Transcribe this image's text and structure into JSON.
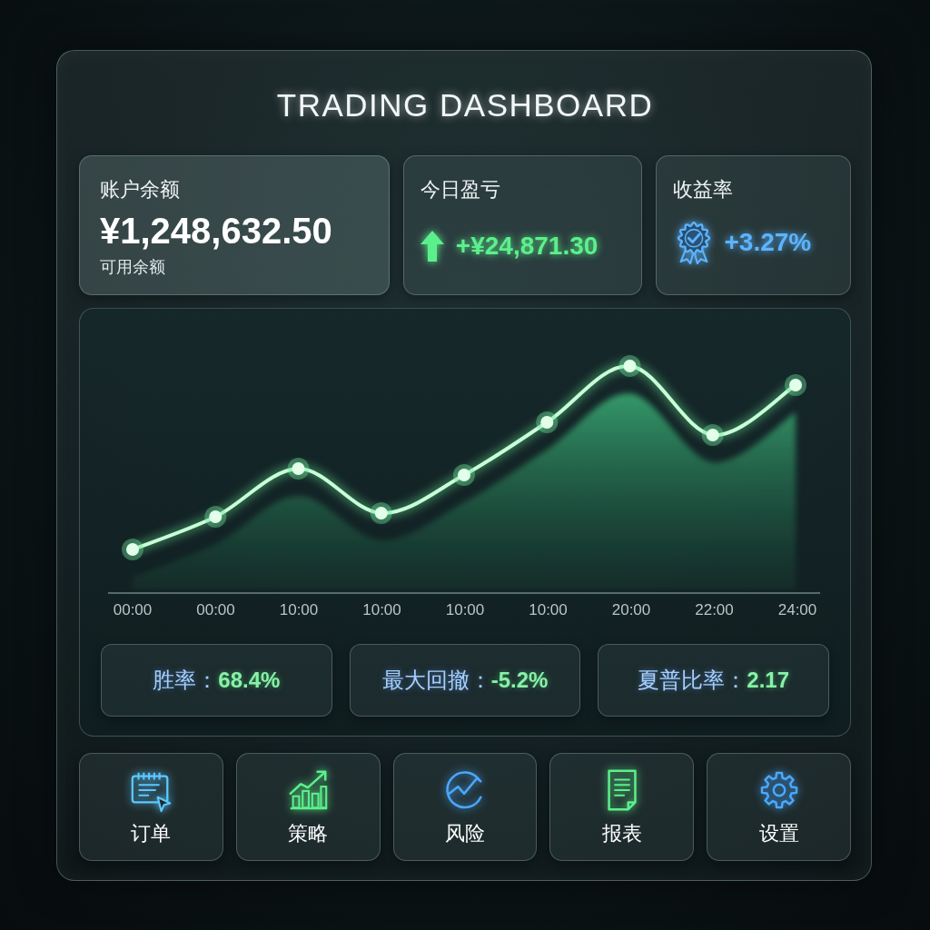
{
  "title": "TRADING DASHBOARD",
  "summary_cards": [
    {
      "kind": "balance",
      "label": "账户余额",
      "value": "¥1,248,632.50",
      "caption": "可用余额"
    },
    {
      "kind": "gain",
      "label": "今日盈亏",
      "value": "+¥24,871.30",
      "color": "#5cf08c"
    },
    {
      "kind": "rate",
      "label": "收益率",
      "value": "+3.27%",
      "color": "#5cb4ff"
    }
  ],
  "chart": {
    "x_labels": [
      "00:00",
      "00:00",
      "10:00",
      "10:00",
      "10:00",
      "10:00",
      "20:00",
      "22:00",
      "24:00"
    ]
  },
  "metrics": [
    {
      "label": "胜率：",
      "value": "68.4%"
    },
    {
      "label": "最大回撤：",
      "value": "-5.2%"
    },
    {
      "label": "夏普比率：",
      "value": "2.17"
    }
  ],
  "nav_buttons": [
    {
      "kind": "orders",
      "label": "订单"
    },
    {
      "kind": "strategy",
      "label": "策略"
    },
    {
      "kind": "risk",
      "label": "风险"
    },
    {
      "kind": "reports",
      "label": "报表"
    },
    {
      "kind": "settings",
      "label": "设置"
    }
  ]
}
